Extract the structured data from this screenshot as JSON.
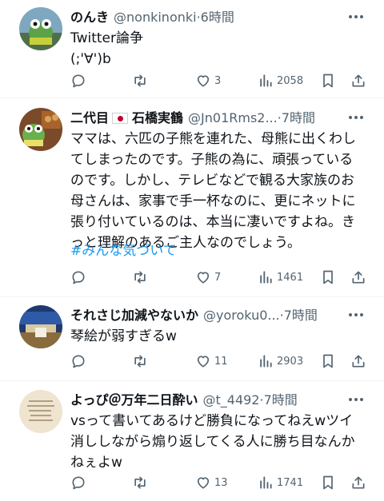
{
  "tweets": [
    {
      "name": "のんき",
      "handle": "@nonkinonki",
      "separator": "·",
      "time": "6時間",
      "text": "Twitter論争\n(;'∀')b",
      "hashtag": "",
      "replies": "",
      "retweets": "",
      "likes": "3",
      "views": "2058"
    },
    {
      "name": "二代目",
      "name_suffix": "石橋実鶴",
      "handle": "@Jn01Rms2...",
      "separator": "·",
      "time": "7時間",
      "text": "ママは、六匹の子熊を連れた、母熊に出くわし\nてしまったのです。子熊の為に、頑張っている\nのです。しかし、テレビなどで観る大家族のお\n母さんは、家事で手一杯なのに、更にネットに\n張り付いているのは、本当に凄いですよね。き\nっと理解のあるご主人なのでしょう。",
      "hashtag": "#みんな気づいて",
      "replies": "",
      "retweets": "",
      "likes": "7",
      "views": "1461"
    },
    {
      "name": "それさじ加減やないか",
      "handle": "@yoroku0...",
      "separator": "·",
      "time": "7時間",
      "text": "琴絵が弱すぎるw",
      "hashtag": "",
      "replies": "",
      "retweets": "",
      "likes": "11",
      "views": "2903"
    },
    {
      "name": "よっぴ＠万年二日酔い",
      "handle": "@t_4492",
      "separator": "·",
      "time": "7時間",
      "text": "vsって書いてあるけど勝負になってねえwツイ\n消ししながら煽り返してくる人に勝ち目なんか\nねぇよw",
      "hashtag": "",
      "replies": "",
      "retweets": "",
      "likes": "13",
      "views": "1741"
    }
  ],
  "icons": {
    "reply": "reply-icon",
    "retweet": "retweet-icon",
    "like": "heart-icon",
    "views": "views-icon",
    "bookmark": "bookmark-icon",
    "share": "share-icon",
    "more": "more-icon"
  },
  "colors": {
    "text": "#0f1419",
    "secondary": "#536471",
    "link": "#1d9bf0",
    "divider": "#eff3f4"
  }
}
